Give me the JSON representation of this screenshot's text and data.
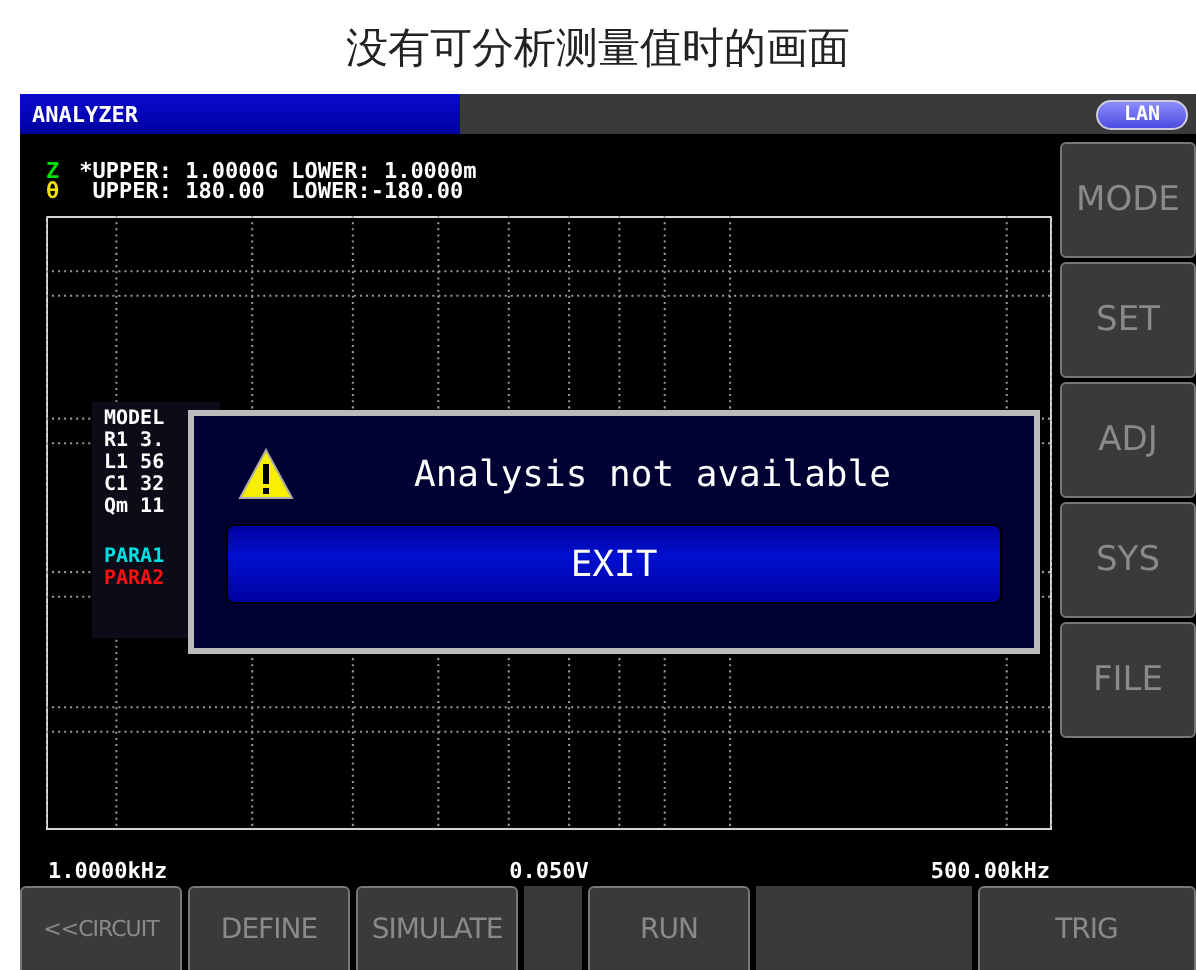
{
  "caption": "没有可分析测量值时的画面",
  "header": {
    "title": "ANALYZER",
    "badge": "LAN"
  },
  "limits": [
    {
      "param": "Z",
      "color": "#00e000",
      "text": "*UPPER: 1.0000G LOWER: 1.0000m"
    },
    {
      "param": "θ",
      "color": "#f0e000",
      "text": " UPPER: 180.00  LOWER:-180.00"
    }
  ],
  "model_panel": {
    "title": "MODEL",
    "lines": [
      "R1 3.",
      "L1 56",
      "C1 32",
      "Qm 11"
    ],
    "params": [
      {
        "label": "PARA1",
        "color": "#00e0e0"
      },
      {
        "label": "PARA2",
        "color": "#ff1010"
      }
    ]
  },
  "dialog": {
    "message": "Analysis not available",
    "button": "EXIT"
  },
  "side_buttons": [
    {
      "label": "MODE",
      "disabled": true
    },
    {
      "label": "SET",
      "disabled": true
    },
    {
      "label": "ADJ",
      "disabled": true
    },
    {
      "label": "SYS",
      "disabled": true
    },
    {
      "label": "FILE",
      "disabled": true
    }
  ],
  "axis_labels": [
    "1.0000kHz",
    "0.050V",
    "500.00kHz"
  ],
  "function_keys": [
    {
      "kind": "key",
      "label": "<<CIRCUIT",
      "disabled": true
    },
    {
      "kind": "key",
      "label": "DEFINE",
      "disabled": true
    },
    {
      "kind": "key",
      "label": "SIMULATE",
      "disabled": true
    },
    {
      "kind": "blank"
    },
    {
      "kind": "key",
      "label": "RUN",
      "disabled": true
    },
    {
      "kind": "blank"
    },
    {
      "kind": "key",
      "label": "TRIG",
      "disabled": true
    }
  ]
}
